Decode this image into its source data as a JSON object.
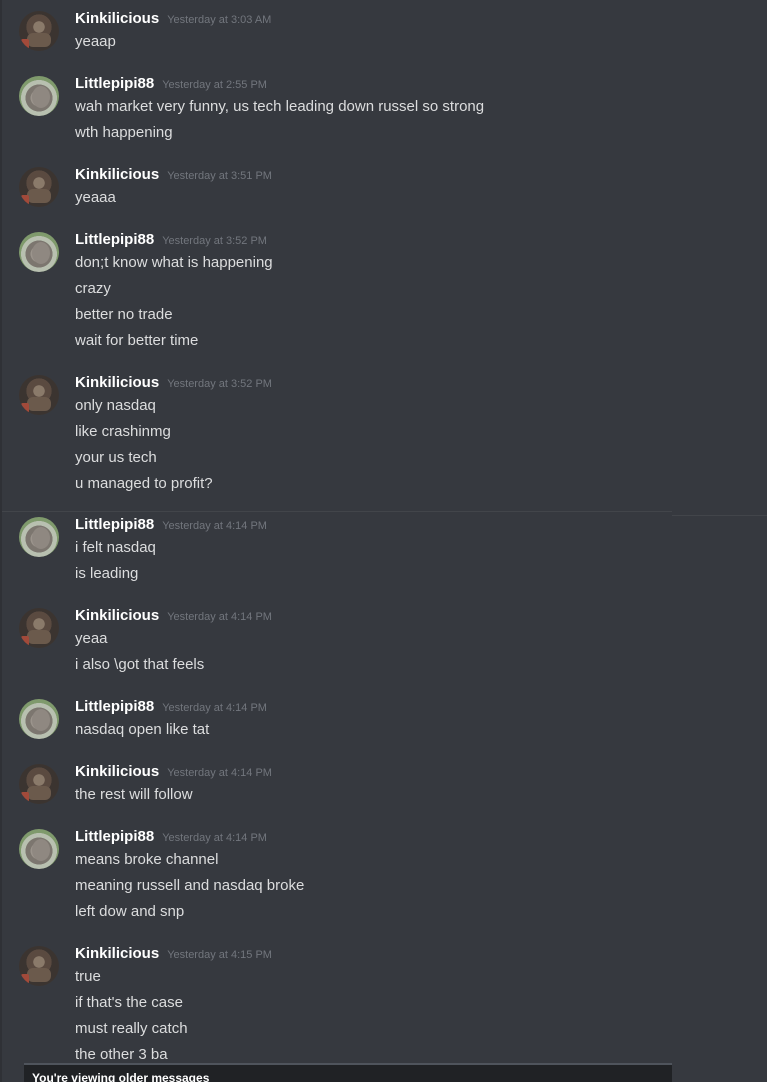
{
  "messages": [
    {
      "author": "Kinkilicious",
      "time": "Yesterday at 3:03 AM",
      "lines": [
        "yeaap"
      ]
    },
    {
      "author": "Littlepipi88",
      "time": "Yesterday at 2:55 PM",
      "lines": [
        "wah market very funny, us tech leading down russel so strong",
        "wth happening"
      ]
    },
    {
      "author": "Kinkilicious",
      "time": "Yesterday at 3:51 PM",
      "lines": [
        "yeaaa"
      ]
    },
    {
      "author": "Littlepipi88",
      "time": "Yesterday at 3:52 PM",
      "lines": [
        "don;t know what is happening",
        "crazy",
        "better no trade",
        "wait for better time"
      ]
    },
    {
      "author": "Kinkilicious",
      "time": "Yesterday at 3:52 PM",
      "lines": [
        "only nasdaq",
        "like crashinmg",
        "your us tech",
        "u managed to profit?"
      ]
    },
    {
      "author": "Littlepipi88",
      "time": "Yesterday at 4:14 PM",
      "lines": [
        "i felt nasdaq",
        "is leading"
      ]
    },
    {
      "author": "Kinkilicious",
      "time": "Yesterday at 4:14 PM",
      "lines": [
        "yeaa",
        "i also \\got that feels"
      ]
    },
    {
      "author": "Littlepipi88",
      "time": "Yesterday at 4:14 PM",
      "lines": [
        "nasdaq open like tat"
      ]
    },
    {
      "author": "Kinkilicious",
      "time": "Yesterday at 4:14 PM",
      "lines": [
        "the rest will follow"
      ]
    },
    {
      "author": "Littlepipi88",
      "time": "Yesterday at 4:14 PM",
      "lines": [
        "means broke channel",
        "meaning russell and nasdaq broke",
        "left dow and snp"
      ]
    },
    {
      "author": "Kinkilicious",
      "time": "Yesterday at 4:15 PM",
      "lines": [
        "true",
        "if that's the case",
        "must really catch",
        "the other 3 ba"
      ]
    }
  ],
  "banner": {
    "text": "You're viewing older messages"
  },
  "colors": {
    "background": "#36393f",
    "username": "#ffffff",
    "message_text": "#dcddde",
    "timestamp": "#72767d"
  }
}
